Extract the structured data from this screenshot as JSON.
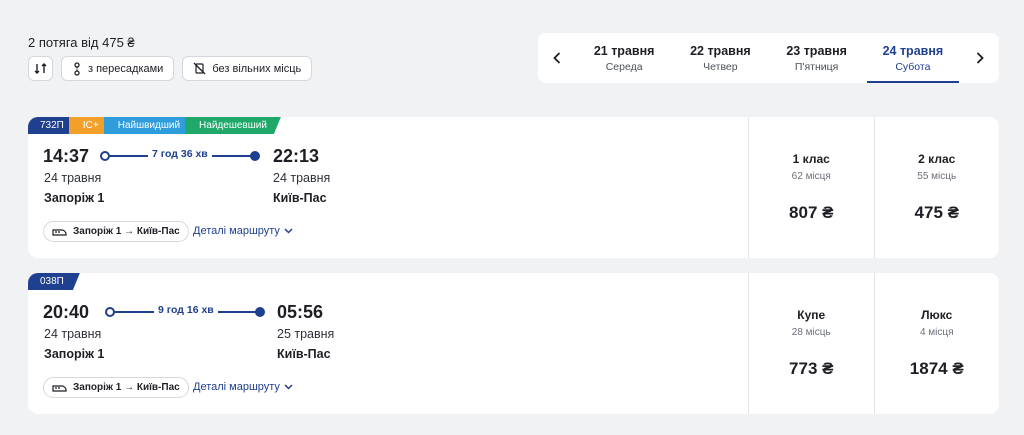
{
  "summary": "2 потяга від 475 ₴",
  "filters": {
    "sort_icon": "sort-icon",
    "transfers_label": "з пересадками",
    "no_seats_label": "без вільних місць"
  },
  "dates": [
    {
      "date": "21 травня",
      "weekday": "Середа",
      "active": false
    },
    {
      "date": "22 травня",
      "weekday": "Четвер",
      "active": false
    },
    {
      "date": "23 травня",
      "weekday": "П'ятниця",
      "active": false
    },
    {
      "date": "24 травня",
      "weekday": "Субота",
      "active": true
    }
  ],
  "trains": [
    {
      "tags": {
        "number": "732П",
        "ic": "IC+",
        "fastest": "Найшвидший",
        "cheapest": "Найдешевший"
      },
      "departure_time": "14:37",
      "duration": "7 год 36 хв",
      "arrival_time": "22:13",
      "departure_date": "24 травня",
      "arrival_date": "24 травня",
      "from": "Запоріж 1",
      "to": "Київ-Пас",
      "route_pill": "Запоріж 1 → Київ-Пас",
      "details": "Деталі маршруту",
      "classes": [
        {
          "name": "1 клас",
          "seats": "62 місця",
          "price": "807 ₴"
        },
        {
          "name": "2 клас",
          "seats": "55 місць",
          "price": "475 ₴"
        }
      ]
    },
    {
      "tags": {
        "number": "038П"
      },
      "departure_time": "20:40",
      "duration": "9 год 16 хв",
      "arrival_time": "05:56",
      "departure_date": "24 травня",
      "arrival_date": "25 травня",
      "from": "Запоріж 1",
      "to": "Київ-Пас",
      "route_pill": "Запоріж 1 → Київ-Пас",
      "details": "Деталі маршруту",
      "classes": [
        {
          "name": "Купе",
          "seats": "28 місць",
          "price": "773 ₴"
        },
        {
          "name": "Люкс",
          "seats": "4 місця",
          "price": "1874 ₴"
        }
      ]
    }
  ],
  "colors": {
    "accent": "#1f3f8f",
    "ic": "#f2a02a",
    "fastest": "#2f9ddc",
    "cheapest": "#1fa86a"
  }
}
